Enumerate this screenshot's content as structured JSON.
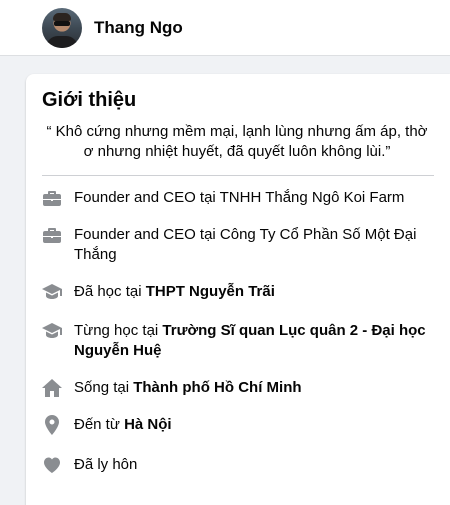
{
  "profile": {
    "name": "Thang Ngo"
  },
  "intro": {
    "title": "Giới thiệu",
    "bio": "“ Khô cứng nhưng mềm mại, lạnh lùng nhưng ấm áp, thờ ơ nhưng nhiệt huyết, đã quyết luôn không lùi.”",
    "items": [
      {
        "icon": "briefcase-icon",
        "prefix": "Founder and CEO tại TNHH Thắng Ngô Koi Farm",
        "bold": ""
      },
      {
        "icon": "briefcase-icon",
        "prefix": "Founder and CEO tại Công Ty Cổ Phần Số Một Đại Thắng",
        "bold": ""
      },
      {
        "icon": "graduation-cap-icon",
        "prefix": "Đã học tại ",
        "bold": "THPT Nguyễn Trãi"
      },
      {
        "icon": "graduation-cap-icon",
        "prefix": "Từng học tại ",
        "bold": "Trường Sĩ quan Lục quân 2 - Đại học Nguyễn Huệ"
      },
      {
        "icon": "home-icon",
        "prefix": "Sống tại ",
        "bold": "Thành phố Hồ Chí Minh"
      },
      {
        "icon": "location-pin-icon",
        "prefix": "Đến từ ",
        "bold": "Hà Nội"
      },
      {
        "icon": "heart-icon",
        "prefix": "Đã ly hôn",
        "bold": ""
      }
    ]
  },
  "colors": {
    "icon": "#8a8d91",
    "text": "#050505",
    "background": "#f0f2f5"
  }
}
